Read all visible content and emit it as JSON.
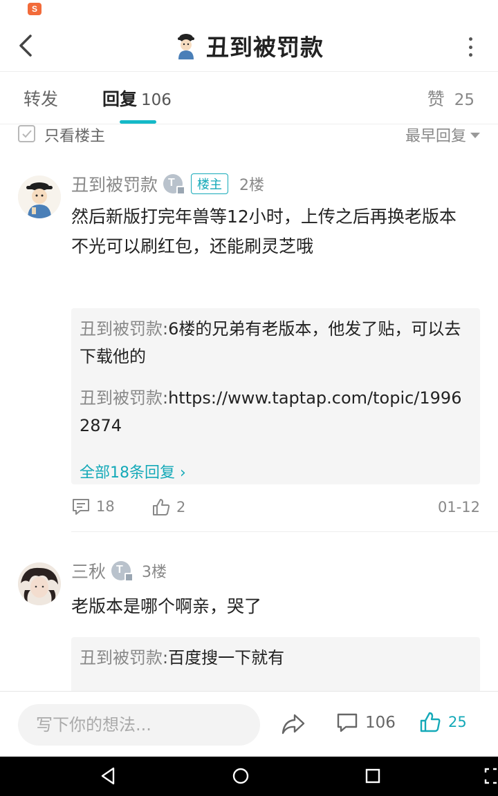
{
  "status_bar": {
    "app_icon": "sogou-input-icon",
    "app_icon_glyph": "S"
  },
  "header": {
    "title": "丑到被罚款",
    "back_icon": "chevron-left-icon",
    "more_icon": "more-vertical-icon"
  },
  "tabs": {
    "forward": {
      "label": "转发"
    },
    "reply": {
      "label": "回复",
      "count": "106"
    },
    "like": {
      "label": "赞",
      "count": "25"
    }
  },
  "filter": {
    "only_op_label": "只看楼主",
    "only_op_checked": false,
    "sort_label": "最早回复"
  },
  "comments": [
    {
      "author": "丑到被罚款",
      "badge": "楼主",
      "floor": "2楼",
      "lines": [
        "然后新版打完年兽等12小时，上传之后再换老版本",
        "不光可以刷红包，还能刷灵芝哦"
      ],
      "replies": [
        {
          "author": "丑到被罚款",
          "colon": ":",
          "text": "6楼的兄弟有老版本，他发了贴，可以去下载他的"
        },
        {
          "author": "丑到被罚款",
          "colon": ":",
          "text": "https://www.taptap.com/topic/19962874"
        }
      ],
      "more_replies": "全部18条回复 ›",
      "comment_count": "18",
      "like_count": "2",
      "date": "01-12"
    },
    {
      "author": "三秋",
      "floor": "3楼",
      "lines": [
        "老版本是哪个啊亲，哭了"
      ],
      "replies": [
        {
          "author": "丑到被罚款",
          "colon": ":",
          "text": "百度搜一下就有"
        }
      ]
    }
  ],
  "bottom_bar": {
    "compose_placeholder": "写下你的想法...",
    "comment_count": "106",
    "like_count": "25"
  },
  "colors": {
    "accent": "#14b9c8",
    "text": "#222222",
    "muted": "#888888"
  }
}
